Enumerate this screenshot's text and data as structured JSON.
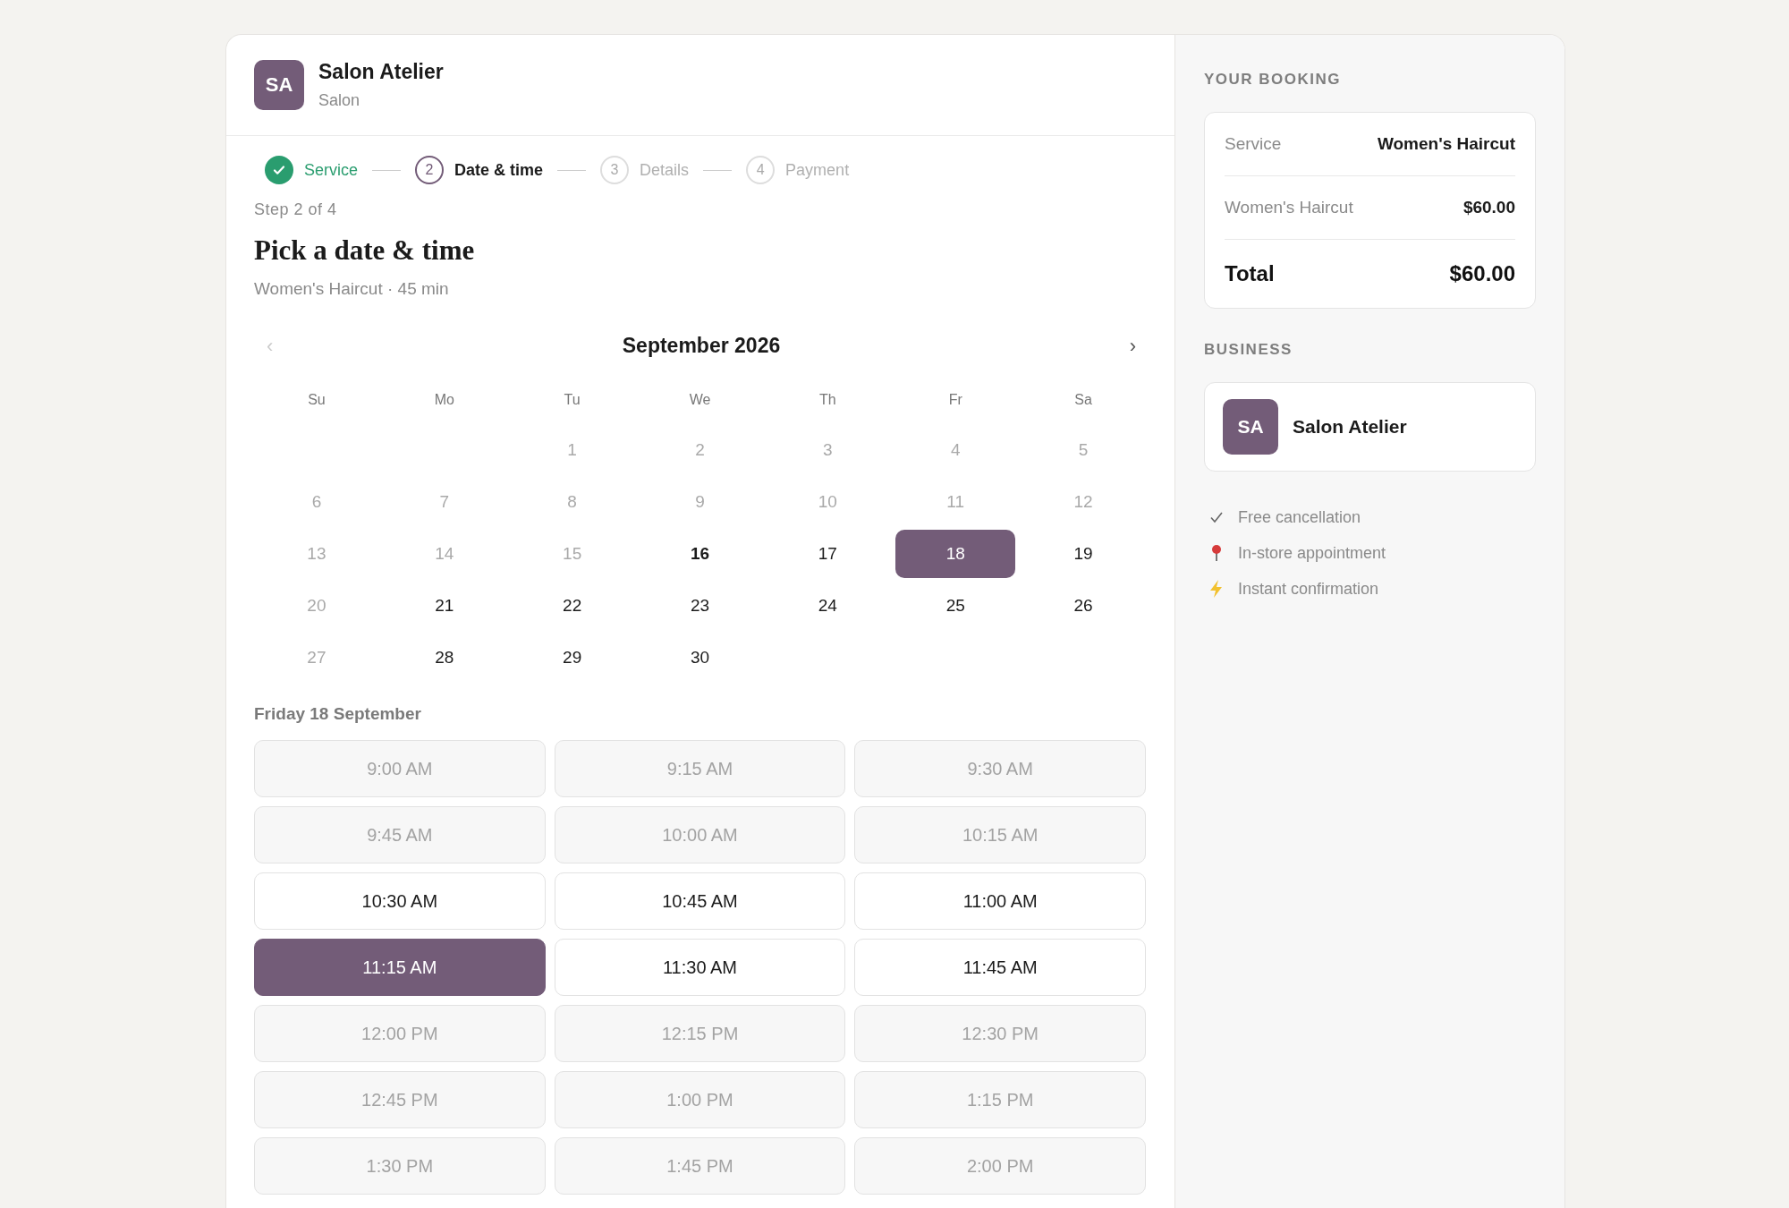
{
  "business": {
    "initials": "SA",
    "name": "Salon Atelier",
    "category": "Salon"
  },
  "steps": [
    {
      "label": "Service",
      "done": true,
      "selected": false
    },
    {
      "number": "2",
      "label": "Date & time",
      "done": false,
      "selected": true
    },
    {
      "number": "3",
      "label": "Details",
      "done": false,
      "selected": false
    },
    {
      "number": "4",
      "label": "Payment",
      "done": false,
      "selected": false
    }
  ],
  "step_caption": "Step 2 of 4",
  "heading": "Pick a date & time",
  "subheading": "Women's Haircut · 45 min",
  "calendar": {
    "month": "September 2026",
    "prev": "‹",
    "next": "›",
    "prev_disabled": true,
    "weekdays": [
      "Su",
      "Mo",
      "Tu",
      "We",
      "Th",
      "Fr",
      "Sa"
    ],
    "weeks": [
      {
        "days": [
          {
            "label": "1",
            "kind": "past",
            "selected": false
          },
          {
            "label": "2",
            "kind": "past",
            "selected": false
          },
          {
            "label": "3",
            "kind": "past",
            "selected": false
          },
          {
            "label": "4",
            "kind": "past",
            "selected": false
          },
          {
            "label": "5",
            "kind": "past",
            "selected": false
          }
        ]
      },
      {
        "days": [
          {
            "label": "6",
            "kind": "past",
            "selected": false
          },
          {
            "label": "7",
            "kind": "past",
            "selected": false
          },
          {
            "label": "8",
            "kind": "past",
            "selected": false
          },
          {
            "label": "9",
            "kind": "past",
            "selected": false
          },
          {
            "label": "10",
            "kind": "past",
            "selected": false
          },
          {
            "label": "11",
            "kind": "past",
            "selected": false
          },
          {
            "label": "12",
            "kind": "past",
            "selected": false
          }
        ]
      },
      {
        "days": [
          {
            "label": "13",
            "kind": "past",
            "selected": false
          },
          {
            "label": "14",
            "kind": "past",
            "selected": false
          },
          {
            "label": "15",
            "kind": "past",
            "selected": false
          },
          {
            "label": "16",
            "kind": "today",
            "selected": false
          },
          {
            "label": "17",
            "kind": "open",
            "selected": false
          },
          {
            "label": "18",
            "kind": "open",
            "selected": true
          },
          {
            "label": "19",
            "kind": "open",
            "selected": false
          }
        ]
      },
      {
        "days": [
          {
            "label": "20",
            "kind": "past",
            "selected": false
          },
          {
            "label": "21",
            "kind": "open",
            "selected": false
          },
          {
            "label": "22",
            "kind": "open",
            "selected": false
          },
          {
            "label": "23",
            "kind": "open",
            "selected": false
          },
          {
            "label": "24",
            "kind": "open",
            "selected": false
          },
          {
            "label": "25",
            "kind": "open",
            "selected": false
          },
          {
            "label": "26",
            "kind": "open",
            "selected": false
          }
        ]
      },
      {
        "days": [
          {
            "label": "27",
            "kind": "past",
            "selected": false
          },
          {
            "label": "28",
            "kind": "open",
            "selected": false
          },
          {
            "label": "29",
            "kind": "open",
            "selected": false
          },
          {
            "label": "30",
            "kind": "open",
            "selected": false
          }
        ]
      }
    ]
  },
  "slots_title": "Friday 18 September",
  "slots": [
    {
      "time": "9:00 AM",
      "disabled": true,
      "selected": false
    },
    {
      "time": "9:15 AM",
      "disabled": true,
      "selected": false
    },
    {
      "time": "9:30 AM",
      "disabled": true,
      "selected": false
    },
    {
      "time": "9:45 AM",
      "disabled": true,
      "selected": false
    },
    {
      "time": "10:00 AM",
      "disabled": true,
      "selected": false
    },
    {
      "time": "10:15 AM",
      "disabled": true,
      "selected": false
    },
    {
      "time": "10:30 AM",
      "disabled": false,
      "selected": false
    },
    {
      "time": "10:45 AM",
      "disabled": false,
      "selected": false
    },
    {
      "time": "11:00 AM",
      "disabled": false,
      "selected": false
    },
    {
      "time": "11:15 AM",
      "disabled": false,
      "selected": true
    },
    {
      "time": "11:30 AM",
      "disabled": false,
      "selected": false
    },
    {
      "time": "11:45 AM",
      "disabled": false,
      "selected": false
    },
    {
      "time": "12:00 PM",
      "disabled": true,
      "selected": false
    },
    {
      "time": "12:15 PM",
      "disabled": true,
      "selected": false
    },
    {
      "time": "12:30 PM",
      "disabled": true,
      "selected": false
    },
    {
      "time": "12:45 PM",
      "disabled": true,
      "selected": false
    },
    {
      "time": "1:00 PM",
      "disabled": true,
      "selected": false
    },
    {
      "time": "1:15 PM",
      "disabled": true,
      "selected": false
    },
    {
      "time": "1:30 PM",
      "disabled": true,
      "selected": false
    },
    {
      "time": "1:45 PM",
      "disabled": true,
      "selected": false
    },
    {
      "time": "2:00 PM",
      "disabled": true,
      "selected": false
    }
  ],
  "summary": {
    "title": "YOUR BOOKING",
    "rows": [
      {
        "label": "Service",
        "value": "Women's Haircut",
        "kind": "detail"
      },
      {
        "label": "Women's Haircut",
        "value": "$60.00",
        "kind": "detail"
      },
      {
        "label": "Total",
        "value": "$60.00",
        "kind": "total"
      }
    ],
    "business_title": "BUSINESS",
    "business": {
      "initials": "SA",
      "name": "Salon Atelier"
    },
    "features": [
      {
        "kind": "check",
        "text": "Free cancellation"
      },
      {
        "kind": "pin",
        "text": "In-store appointment"
      },
      {
        "kind": "bolt",
        "text": "Instant confirmation"
      }
    ]
  }
}
